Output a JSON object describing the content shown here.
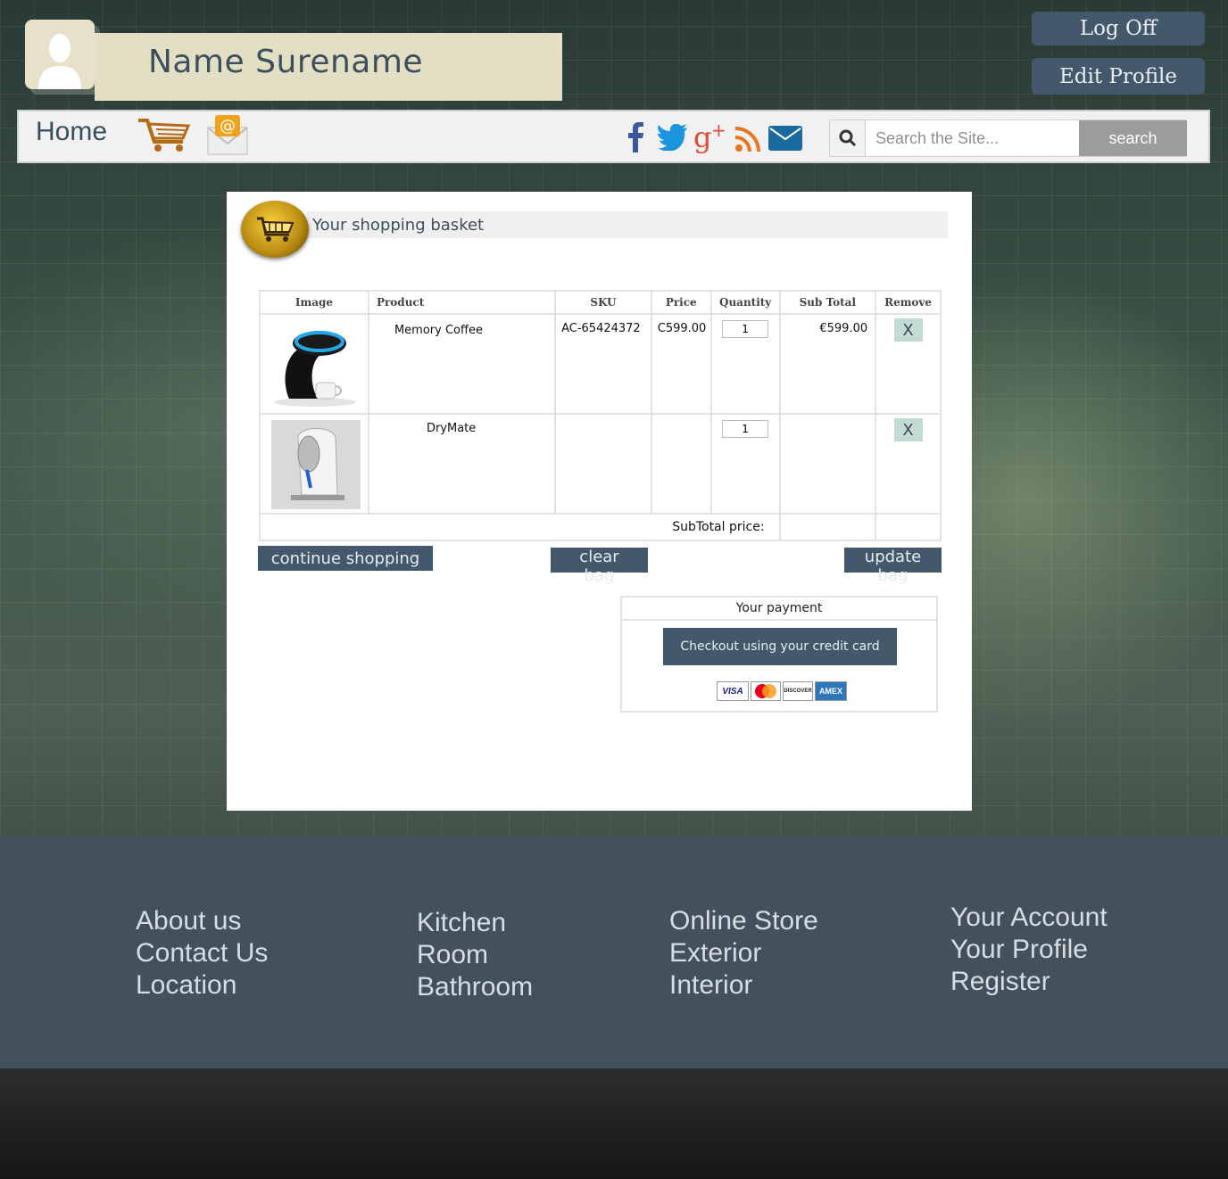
{
  "user": {
    "name": "Name Surename"
  },
  "account_buttons": {
    "log_off": "Log Off",
    "edit_profile": "Edit Profile"
  },
  "nav": {
    "home": "Home",
    "search_placeholder": "Search the Site...",
    "search_button": "search"
  },
  "basket": {
    "title": "Your shopping basket",
    "columns": [
      "Image",
      "Product",
      "SKU",
      "Price",
      "Quantity",
      "Sub Total",
      "Remove"
    ],
    "rows": [
      {
        "product": "Memory Coffee",
        "sku": "AC-65424372",
        "price": "C599.00",
        "quantity": "1",
        "subtotal": "€599.00",
        "remove": "X"
      },
      {
        "product": "DryMate",
        "sku": "",
        "price": "",
        "quantity": "1",
        "subtotal": "",
        "remove": "X"
      }
    ],
    "subtotal_label": "SubTotal price:",
    "buttons": {
      "continue": "continue  shopping",
      "clear": "clear bag",
      "update": "update bag"
    }
  },
  "payment": {
    "title": "Your payment",
    "checkout": "Checkout using  your credit card",
    "cards": [
      "VISA",
      "DISCOVER",
      "AMEX"
    ]
  },
  "footer": {
    "col1": [
      "About us",
      "Contact Us",
      "Location"
    ],
    "col2": [
      "Kitchen",
      "Room",
      "Bathroom"
    ],
    "col3": [
      "Online Store",
      "Exterior",
      "Interior"
    ],
    "col4": [
      "Your Account",
      "Your Profile",
      "Register"
    ]
  },
  "colors": {
    "accent": "#43586a",
    "footer": "#43515d",
    "name_bar": "#e3dfc5"
  }
}
